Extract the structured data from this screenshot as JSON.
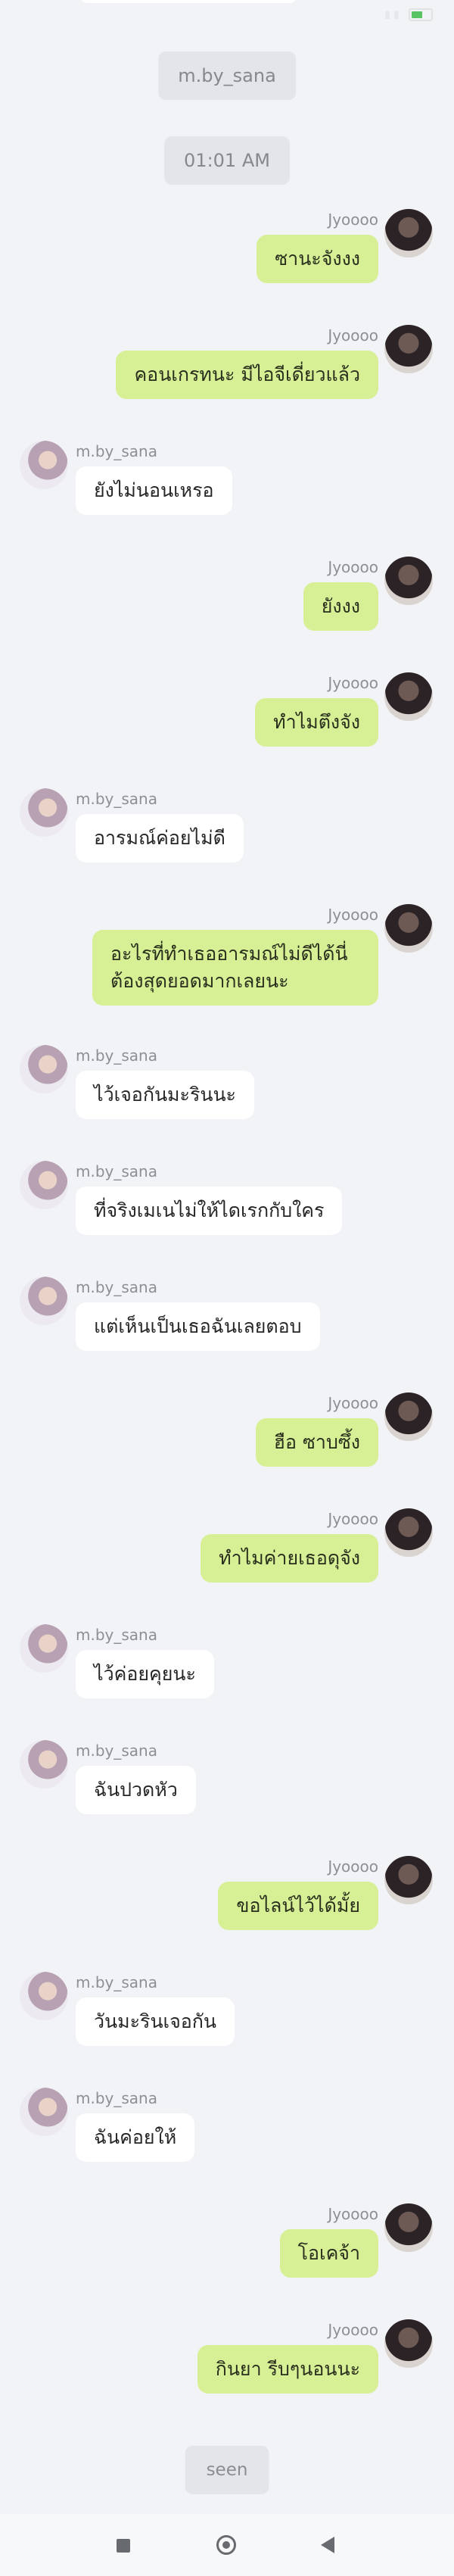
{
  "status_bar": {
    "time": "",
    "icons": ""
  },
  "chips": {
    "username": "m.by_sana",
    "time": "01:01 AM"
  },
  "messages": [
    {
      "side": "right",
      "sender": "Jyoooo",
      "text": "ซานะจังงง"
    },
    {
      "side": "right",
      "sender": "Jyoooo",
      "text": "คอนเกรทนะ มีไอจีเดี่ยวแล้ว"
    },
    {
      "side": "left",
      "sender": "m.by_sana",
      "text": "ยังไม่นอนเหรอ"
    },
    {
      "side": "right",
      "sender": "Jyoooo",
      "text": "ยังงง"
    },
    {
      "side": "right",
      "sender": "Jyoooo",
      "text": "ทำไมตึงจัง"
    },
    {
      "side": "left",
      "sender": "m.by_sana",
      "text": "อารมณ์ค่อยไม่ดี"
    },
    {
      "side": "right",
      "sender": "Jyoooo",
      "text": "อะไรที่ทำเธออารมณ์ไม่ดีได้นี่ ต้องสุดยอดมากเลยนะ"
    },
    {
      "side": "left",
      "sender": "m.by_sana",
      "text": "ไว้เจอกันมะรินนะ"
    },
    {
      "side": "left",
      "sender": "m.by_sana",
      "text": "ที่จริงเมเนไม่ให้ไดเรกกับใคร"
    },
    {
      "side": "left",
      "sender": "m.by_sana",
      "text": "แต่เห็นเป็นเธอฉันเลยตอบ"
    },
    {
      "side": "right",
      "sender": "Jyoooo",
      "text": "ฮือ ซาบซึ้ง"
    },
    {
      "side": "right",
      "sender": "Jyoooo",
      "text": "ทำไมค่ายเธอดุจัง"
    },
    {
      "side": "left",
      "sender": "m.by_sana",
      "text": "ไว้ค่อยคุยนะ"
    },
    {
      "side": "left",
      "sender": "m.by_sana",
      "text": "ฉันปวดหัว"
    },
    {
      "side": "right",
      "sender": "Jyoooo",
      "text": "ขอไลน์ไว้ได้มั้ย"
    },
    {
      "side": "left",
      "sender": "m.by_sana",
      "text": "วันมะรินเจอกัน"
    },
    {
      "side": "left",
      "sender": "m.by_sana",
      "text": "ฉันค่อยให้"
    },
    {
      "side": "right",
      "sender": "Jyoooo",
      "text": "โอเคจ้า"
    },
    {
      "side": "right",
      "sender": "Jyoooo",
      "text": "กินยา รีบๆนอนนะ"
    }
  ],
  "seen_label": "seen",
  "nav": {
    "recents_icon": "square-icon",
    "home_icon": "circle-home-icon",
    "back_icon": "triangle-back-icon"
  }
}
